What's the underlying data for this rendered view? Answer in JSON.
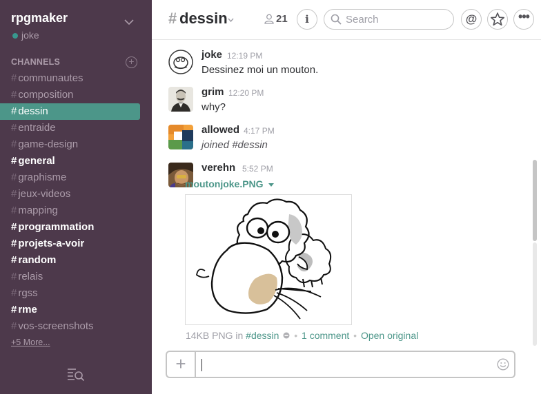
{
  "colors": {
    "sidebar_bg": "#4d394b",
    "active_channel_bg": "#4c9689",
    "link": "#4c9689",
    "presence": "#38978d"
  },
  "sidebar": {
    "team_name": "rpgmaker",
    "user_name": "joke",
    "channels_header": "CHANNELS",
    "add_channel_label": "+",
    "channels": [
      {
        "name": "communautes",
        "state": "read"
      },
      {
        "name": "composition",
        "state": "read"
      },
      {
        "name": "dessin",
        "state": "active"
      },
      {
        "name": "entraide",
        "state": "read"
      },
      {
        "name": "game-design",
        "state": "read"
      },
      {
        "name": "general",
        "state": "unread"
      },
      {
        "name": "graphisme",
        "state": "read"
      },
      {
        "name": "jeux-videos",
        "state": "read"
      },
      {
        "name": "mapping",
        "state": "read"
      },
      {
        "name": "programmation",
        "state": "unread"
      },
      {
        "name": "projets-a-voir",
        "state": "unread"
      },
      {
        "name": "random",
        "state": "unread"
      },
      {
        "name": "relais",
        "state": "read"
      },
      {
        "name": "rgss",
        "state": "read"
      },
      {
        "name": "rme",
        "state": "unread"
      },
      {
        "name": "vos-screenshots",
        "state": "read"
      }
    ],
    "more_label": "+5 More..."
  },
  "header": {
    "hash": "#",
    "channel_title": "dessin",
    "member_count": "21",
    "info_label": "i",
    "search_placeholder": "Search",
    "mention_label": "@",
    "more_label": "•••"
  },
  "messages": [
    {
      "author": "joke",
      "time": "12:19 PM",
      "text": "Dessinez moi un mouton.",
      "avatar": "sheep-sketch-avatar"
    },
    {
      "author": "grim",
      "time": "12:20 PM",
      "text": "why?",
      "avatar": "portrait-photo-avatar"
    },
    {
      "author": "allowed",
      "time": "4:17 PM",
      "text": "joined #dessin",
      "avatar": "color-blocks-avatar"
    },
    {
      "author": "verehn",
      "time": "5:52 PM",
      "text": "",
      "avatar": "painted-face-avatar"
    }
  ],
  "file": {
    "name": "moutonjoke.PNG",
    "size_type": "14KB PNG",
    "in_label": "in",
    "channel_link": "#dessin",
    "comments": "1 comment",
    "open_label": "Open original"
  },
  "composer": {
    "attach_label": "+",
    "placeholder": ""
  }
}
